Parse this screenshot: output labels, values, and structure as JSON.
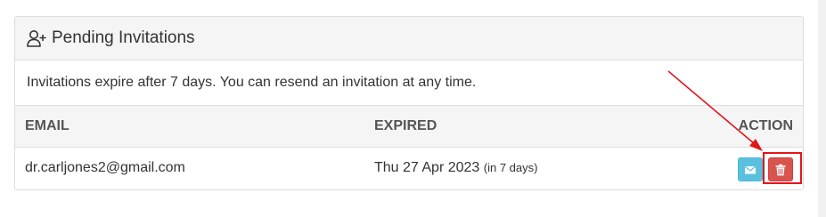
{
  "panel": {
    "title": "Pending Invitations",
    "icon": "user-plus-icon",
    "info_text": "Invitations expire after 7 days. You can resend an invitation at any time."
  },
  "table": {
    "columns": [
      "EMAIL",
      "EXPIRED",
      "ACTION"
    ],
    "rows": [
      {
        "email": "dr.carljones2@gmail.com",
        "expired": "Thu 27 Apr 2023",
        "expired_relative": "(in 7 days)",
        "actions": [
          "envelope-icon",
          "trash-icon"
        ]
      }
    ]
  },
  "colors": {
    "resend_button": "#5bc0de",
    "delete_button": "#d9534f",
    "annotation": "#e3161b"
  }
}
